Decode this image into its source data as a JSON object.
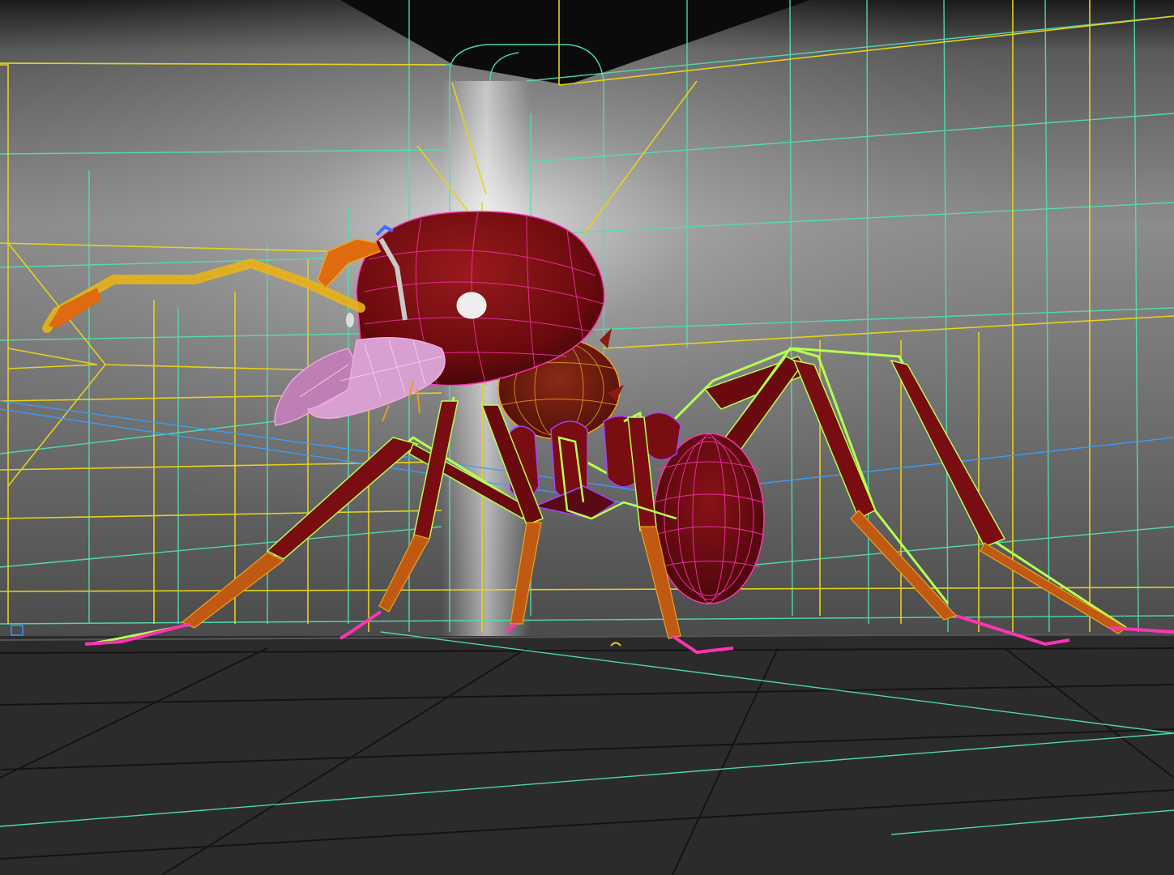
{
  "viewport": {
    "kind": "3d-perspective-viewport",
    "subject": "ant-model",
    "display_mode": "shaded-with-wireframe-on-shaded"
  },
  "colors": {
    "backdrop_light": "#9a9a9a",
    "backdrop_dark": "#3e3e3e",
    "floor": "#2b2b2b",
    "floor_grid": "#141414",
    "cyan_wire": "#4fe0b0",
    "yellow_wire": "#e6d21a",
    "magenta_wire": "#ff33b5",
    "violet_wire": "#9f44ff",
    "pink_wire": "#f5a8e8",
    "orange_wire": "#f0a020",
    "lime_wire": "#b6ff52",
    "blue_wire": "#3a90ff",
    "body_red": "#7a0d12",
    "body_red_dark": "#4a070a",
    "leg_orange": "#c05a12"
  },
  "icons": {
    "light_gizmo": "point-light-icon",
    "pivot_marker": "pivot-marker-icon"
  }
}
